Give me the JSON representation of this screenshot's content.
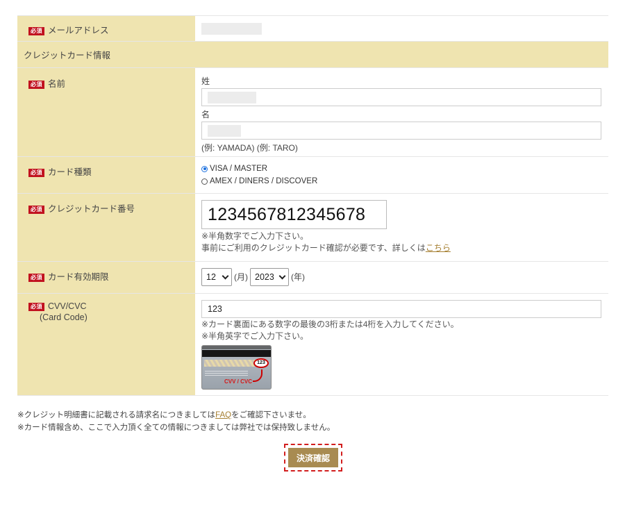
{
  "required_badge": "必須",
  "email": {
    "label": "メールアドレス"
  },
  "card_section": {
    "title": "クレジットカード情報"
  },
  "name": {
    "label": "名前",
    "last_label": "姓",
    "first_label": "名",
    "hint": "(例: YAMADA) (例: TARO)"
  },
  "card_type": {
    "label": "カード種類",
    "options": [
      {
        "label": "VISA / MASTER",
        "selected": true
      },
      {
        "label": "AMEX / DINERS / DISCOVER",
        "selected": false
      }
    ]
  },
  "card_number": {
    "label": "クレジットカード番号",
    "value": "1234567812345678",
    "hint1": "※半角数字でご入力下さい。",
    "hint2": "事前にご利用のクレジットカード確認が必要です、詳しくは",
    "link": "こちら"
  },
  "expiry": {
    "label": "カード有効期限",
    "month": "12",
    "month_unit": "(月)",
    "year": "2023",
    "year_unit": "(年)"
  },
  "cvv": {
    "label": "CVV/CVC",
    "sublabel": "(Card Code)",
    "value": "123",
    "hint1": "※カード裏面にある数字の最後の3桁または4桁を入力してください。",
    "hint2": "※半角英字でご入力下さい。",
    "image_caption": "CVV / CVC",
    "image_code": "123"
  },
  "notes": {
    "line1_before": "※クレジット明細書に記載される請求名につきましては",
    "line1_link": "FAQ",
    "line1_after": "をご確認下さいませ。",
    "line2": "※カード情報含め、ここで入力頂く全ての情報につきましては弊社では保持致しません。"
  },
  "submit": {
    "label": "決済確認"
  },
  "colors": {
    "label_bg": "#efe4b0",
    "required": "#c1121f",
    "submit": "#a88b51",
    "link": "#a57e2f",
    "highlight_border": "#d21d1d"
  }
}
